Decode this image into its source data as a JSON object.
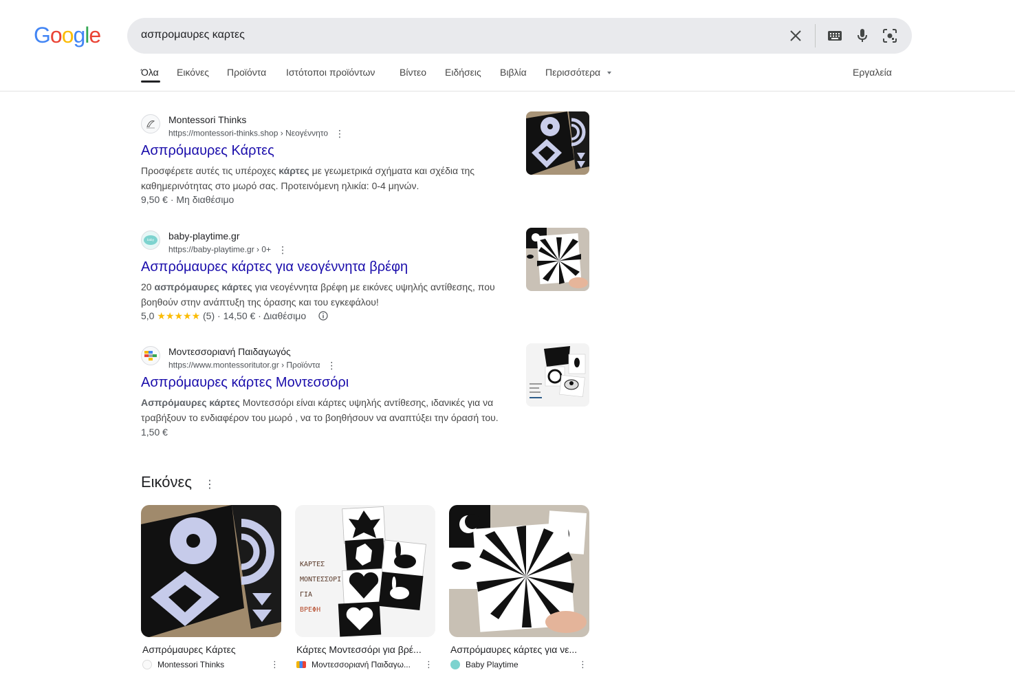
{
  "logo": {
    "text": "Google"
  },
  "search": {
    "query": "ασπρομαυρες καρτες",
    "clear_icon": "close-icon",
    "keyboard_icon": "keyboard-icon",
    "mic_icon": "microphone-icon",
    "lens_icon": "camera-lens-icon"
  },
  "tabs": [
    {
      "label": "Όλα",
      "active": true
    },
    {
      "label": "Εικόνες"
    },
    {
      "label": "Προϊόντα"
    },
    {
      "label": "Ιστότοποι προϊόντων"
    },
    {
      "label": "Βίντεο"
    },
    {
      "label": "Ειδήσεις"
    },
    {
      "label": "Βιβλία"
    },
    {
      "label": "Περισσότερα"
    }
  ],
  "tools_label": "Εργαλεία",
  "results": [
    {
      "site_name": "Montessori Thinks",
      "url": "https://montessori-thinks.shop › Νεογέννητο",
      "title": "Ασπρόμαυρες Κάρτες",
      "snippet_pre": "Προσφέρετε αυτές τις υπέροχες ",
      "snippet_bold": "κάρτες",
      "snippet_post": " με γεωμετρικά σχήματα και σχέδια της καθημερινότητας στο μωρό σας. Προτεινόμενη ηλικία: 0-4 μηνών.",
      "meta": "9,50 € · Μη διαθέσιμο"
    },
    {
      "site_name": "baby-playtime.gr",
      "url": "https://baby-playtime.gr › 0+",
      "title": "Ασπρόμαυρες κάρτες για νεογέννητα βρέφη",
      "snippet_pre": "20 ",
      "snippet_bold": "ασπρόμαυρες κάρτες",
      "snippet_post": " για νεογέννητα βρέφη με εικόνες υψηλής αντίθεσης, που βοηθούν στην ανάπτυξη της όρασης και του εγκεφάλου!",
      "rating": "5,0",
      "stars": "★★★★★",
      "meta_after": "(5) · 14,50 € · Διαθέσιμο"
    },
    {
      "site_name": "Μοντεσσοριανή Παιδαγωγός",
      "url": "https://www.montessoritutor.gr › Προϊόντα",
      "title": "Ασπρόμαυρες κάρτες Μοντεσσόρι",
      "snippet_pre": "",
      "snippet_bold": "Ασπρόμαυρες κάρτες",
      "snippet_post": " Μοντεσσόρι είναι κάρτες υψηλής αντίθεσης, ιδανικές για να τραβήξουν το ενδιαφέρον του μωρό , να το βοηθήσουν να αναπτύξει την όρασή του.",
      "meta": "1,50 €"
    }
  ],
  "images_section": {
    "heading": "Εικόνες",
    "items": [
      {
        "title": "Ασπρόμαυρες Κάρτες",
        "source": "Montessori Thinks"
      },
      {
        "title": "Κάρτες Μοντεσσόρι για βρέ...",
        "source": "Μοντεσσοριανή Παιδαγω...",
        "card_text": [
          "ΚΑΡΤΕΣ",
          "ΜΟΝΤΕΣΣΟΡΙ",
          "ΓΙΑ",
          "ΒΡΕΦΗ"
        ]
      },
      {
        "title": "Ασπρόμαυρες κάρτες για νε...",
        "source": "Baby Playtime"
      }
    ]
  },
  "colors": {
    "link": "#1a0dab",
    "star": "#fbbc04",
    "search_bg": "#e9eaed"
  }
}
